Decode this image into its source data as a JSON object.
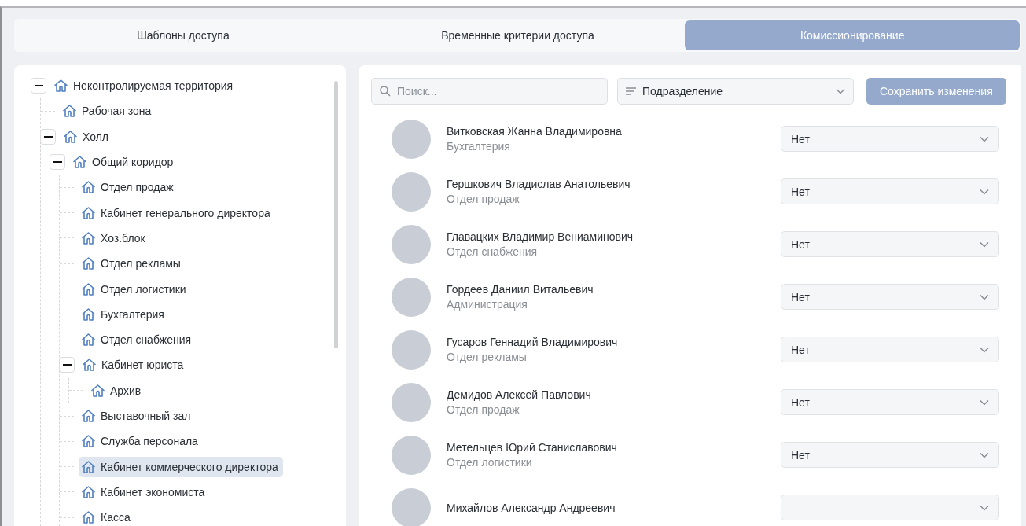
{
  "tabs": [
    {
      "label": "Шаблоны доступа",
      "selected": false
    },
    {
      "label": "Временные критерии доступа",
      "selected": false
    },
    {
      "label": "Комиссионирование",
      "selected": true
    }
  ],
  "tree": [
    {
      "label": "Неконтролируемая территория",
      "expanded": true,
      "selected": false,
      "children": [
        {
          "label": "Рабочая зона",
          "selected": false
        },
        {
          "label": "Холл",
          "expanded": true,
          "selected": false,
          "children": [
            {
              "label": "Общий коридор",
              "expanded": true,
              "selected": false,
              "children": [
                {
                  "label": "Отдел продаж",
                  "selected": false
                },
                {
                  "label": "Кабинет генерального директора",
                  "selected": false
                },
                {
                  "label": "Хоз.блок",
                  "selected": false
                },
                {
                  "label": "Отдел рекламы",
                  "selected": false
                },
                {
                  "label": "Отдел логистики",
                  "selected": false
                },
                {
                  "label": "Бухгалтерия",
                  "selected": false
                },
                {
                  "label": "Отдел снабжения",
                  "selected": false
                },
                {
                  "label": "Кабинет юриста",
                  "expanded": true,
                  "selected": false,
                  "children": [
                    {
                      "label": "Архив",
                      "selected": false
                    }
                  ]
                },
                {
                  "label": "Выставочный зал",
                  "selected": false
                },
                {
                  "label": "Служба персонала",
                  "selected": false
                },
                {
                  "label": "Кабинет коммерческого директора",
                  "selected": true
                },
                {
                  "label": "Кабинет экономиста",
                  "selected": false
                },
                {
                  "label": "Касса",
                  "selected": false
                }
              ]
            }
          ]
        }
      ]
    }
  ],
  "toolbar": {
    "search": {
      "placeholder": "Поиск..."
    },
    "filter": {
      "value": "Подразделение"
    },
    "save_button": {
      "label": "Сохранить изменения",
      "disabled": true
    }
  },
  "people": [
    {
      "name": "Витковская Жанна Владимировна",
      "department": "Бухгалтерия",
      "value": "Нет"
    },
    {
      "name": "Гершкович Владислав Анатольевич",
      "department": "Отдел продаж",
      "value": "Нет"
    },
    {
      "name": "Главацких Владимир Вениаминович",
      "department": "Отдел снабжения",
      "value": "Нет"
    },
    {
      "name": "Гордеев Даниил Витальевич",
      "department": "Администрация",
      "value": "Нет"
    },
    {
      "name": "Гусаров Геннадий Владимирович",
      "department": "Отдел рекламы",
      "value": "Нет"
    },
    {
      "name": "Демидов Алексей Павлович",
      "department": "Отдел продаж",
      "value": "Нет"
    },
    {
      "name": "Метельцев Юрий Станиславович",
      "department": "Отдел логистики",
      "value": "Нет"
    },
    {
      "name": "Михайлов Александр Андреевич"
    }
  ]
}
